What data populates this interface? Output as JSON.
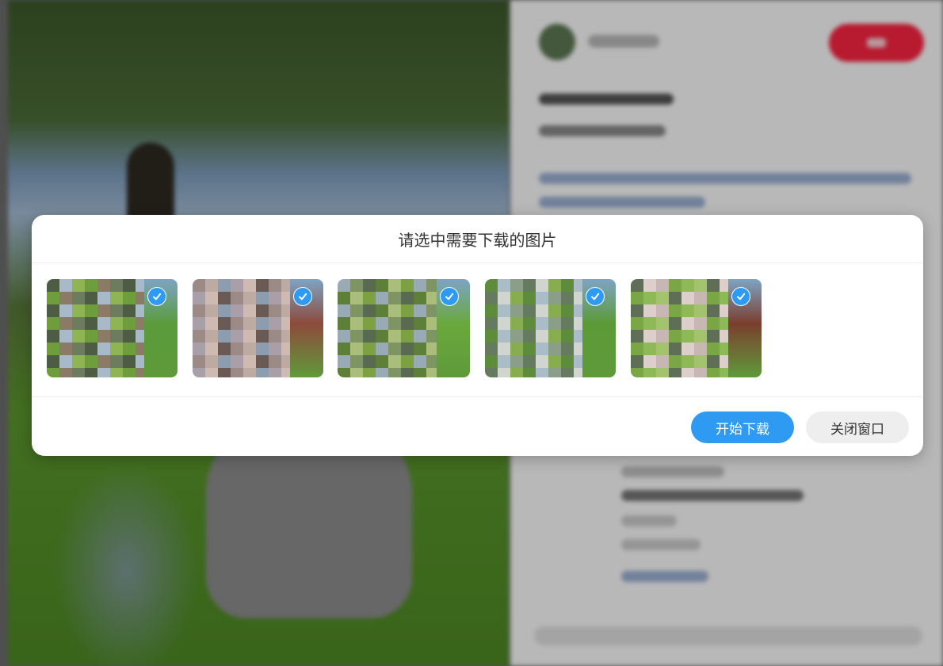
{
  "dialog": {
    "title": "请选中需要下载的图片",
    "images": [
      {
        "label": "image-1",
        "selected": true,
        "tone": [
          "#4d5d44",
          "#6d7b5f",
          "#8a7a66",
          "#6e9d3c",
          "#8fb552",
          "#a8b9c9"
        ],
        "edge": "#5a9b3b"
      },
      {
        "label": "image-2",
        "selected": true,
        "tone": [
          "#bdaaa3",
          "#9c8a86",
          "#6b5a54",
          "#cfbab2",
          "#a99fa9",
          "#8c9db0"
        ],
        "edge": "#8d4a3b"
      },
      {
        "label": "image-3",
        "selected": true,
        "tone": [
          "#5a6a50",
          "#7e9462",
          "#9aaab5",
          "#7da043",
          "#a9be7b",
          "#5d7f3a"
        ],
        "edge": "#6aa83d"
      },
      {
        "label": "image-4",
        "selected": true,
        "tone": [
          "#667a60",
          "#8b9e87",
          "#a9bcc7",
          "#5d8d3a",
          "#88ad4e",
          "#d0d6cf"
        ],
        "edge": "#5c9a37"
      },
      {
        "label": "image-5",
        "selected": true,
        "tone": [
          "#8eb957",
          "#7aa645",
          "#c8b6b4",
          "#dccfc9",
          "#5f6e56",
          "#a5c36c"
        ],
        "edge": "#7b3e2e"
      }
    ],
    "start_label": "开始下载",
    "close_label": "关闭窗口"
  },
  "colors": {
    "accent": "#2e9af2",
    "follow": "#ff2442"
  }
}
